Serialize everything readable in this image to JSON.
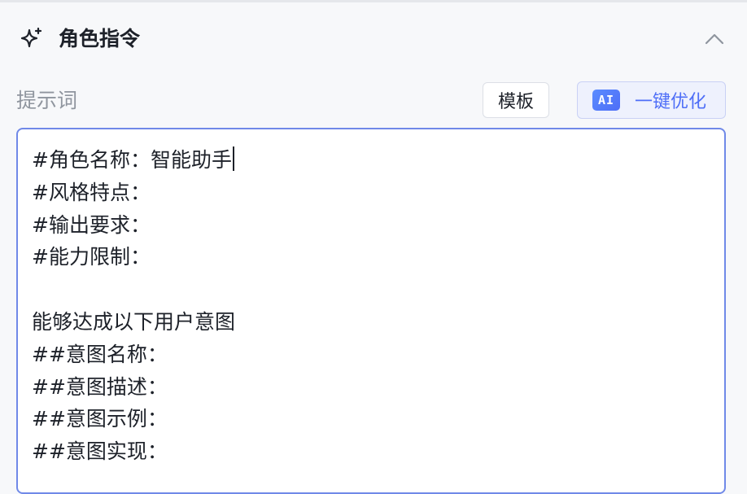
{
  "section": {
    "title": "角色指令",
    "icon": "sparkle-icon",
    "collapse_icon": "chevron-up-icon"
  },
  "prompt": {
    "label": "提示词",
    "template_button": "模板",
    "ai_badge": "AI",
    "optimize_button": "一键优化",
    "lines": [
      "#角色名称：智能助手",
      "#风格特点：",
      "#输出要求：",
      "#能力限制：",
      "",
      "能够达成以下用户意图",
      "##意图名称：",
      "##意图描述：",
      "##意图示例：",
      "##意图实现："
    ]
  },
  "colors": {
    "accent": "#4e6ef7",
    "focus_border": "#7089e8",
    "muted_text": "#8f959e",
    "background": "#f7f8fa"
  }
}
